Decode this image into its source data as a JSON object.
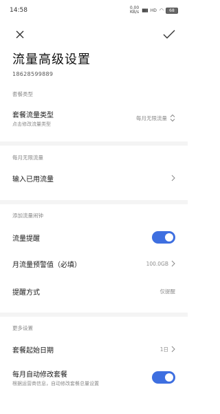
{
  "status_bar": {
    "time": "14:58",
    "speed_text": "0.00\nKB/s",
    "network": "HD",
    "battery": "68"
  },
  "navbar": {
    "close_icon": "close-icon",
    "confirm_icon": "check-icon"
  },
  "header": {
    "title": "流量高级设置",
    "phone": "18628599889"
  },
  "sections": {
    "plan_type": {
      "label": "套餐类型",
      "item_title": "套餐流量类型",
      "item_subtitle": "点击修改流量类型",
      "item_value": "每月无限流量"
    },
    "monthly_unlimited": {
      "label": "每月无限流量",
      "item_title": "输入已用流量"
    },
    "alarm": {
      "label": "添加流量闹钟",
      "reminder_title": "流量提醒",
      "reminder_on": true,
      "threshold_title": "月流量预警值（必填）",
      "threshold_value": "100.0GB",
      "method_title": "提醒方式",
      "method_value": "仅提醒"
    },
    "more": {
      "label": "更多设置",
      "start_date_title": "套餐起始日期",
      "start_date_value": "1日",
      "auto_modify_title": "每月自动修改套餐",
      "auto_modify_subtitle": "根据运营商信息，自动修改套餐总量设置",
      "auto_modify_on": true
    }
  },
  "colors": {
    "accent": "#3e6fe0",
    "section_label": "#8a8a8a",
    "divider": "#f4f4f4"
  }
}
